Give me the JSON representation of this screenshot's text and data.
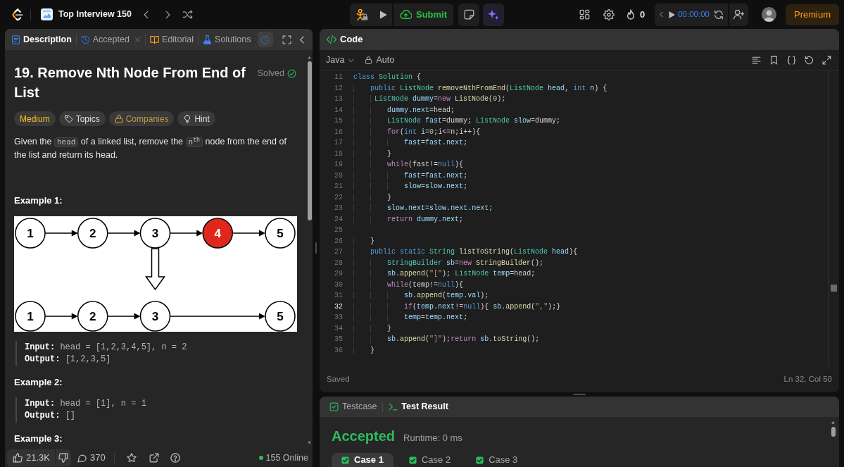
{
  "top_bar": {
    "study_plan": "Top Interview 150",
    "submit": "Submit",
    "streak": "0",
    "timer": "00:00:00",
    "premium": "Premium"
  },
  "description_panel": {
    "tabs": [
      {
        "kind": "description",
        "label": "Description",
        "selected": true,
        "closable": false
      },
      {
        "kind": "submission",
        "label": "Accepted",
        "selected": false,
        "closable": true
      },
      {
        "kind": "editorial",
        "label": "Editorial",
        "selected": false,
        "closable": false
      },
      {
        "kind": "solutions",
        "label": "Solutions",
        "selected": false,
        "closable": false
      }
    ],
    "title": "19. Remove Nth Node From End of List",
    "status": "Solved",
    "tags": [
      {
        "kind": "difficulty",
        "label": "Medium"
      },
      {
        "kind": "topics",
        "label": "Topics"
      },
      {
        "kind": "companies",
        "label": "Companies"
      },
      {
        "kind": "hint",
        "label": "Hint"
      }
    ],
    "statement": [
      {
        "kind": "text",
        "text": "Given the "
      },
      {
        "kind": "code",
        "text": "head"
      },
      {
        "kind": "text",
        "text": " of a linked list, remove the "
      },
      {
        "kind": "code",
        "text": "n$^{th}$"
      },
      {
        "kind": "text",
        "text": " node from the end of the list and return its head."
      }
    ],
    "examples": [
      {
        "title": "Example 1:",
        "diagram": {
          "rows": [
            {
              "nodes": [
                {
                  "label": "1",
                  "highlighted": false
                },
                {
                  "label": "2",
                  "highlighted": false
                },
                {
                  "label": "3",
                  "highlighted": false
                },
                {
                  "label": "4",
                  "highlighted": true
                },
                {
                  "label": "5",
                  "highlighted": false
                }
              ]
            },
            {
              "nodes": [
                {
                  "label": "1",
                  "highlighted": false
                },
                {
                  "label": "2",
                  "highlighted": false
                },
                {
                  "label": "3",
                  "highlighted": false
                },
                {
                  "label": "5",
                  "highlighted": false
                }
              ]
            }
          ]
        },
        "input_label": "Input:",
        "input": "head = [1,2,3,4,5], n = 2",
        "output_label": "Output:",
        "output": "[1,2,3,5]"
      },
      {
        "title": "Example 2:",
        "input_label": "Input:",
        "input": "head = [1], n = 1",
        "output_label": "Output:",
        "output": "[]"
      },
      {
        "title": "Example 3:"
      }
    ],
    "footer": {
      "likes": "21.3K",
      "comments": "370",
      "online": "155 Online"
    }
  },
  "code_panel": {
    "title": "Code",
    "language": "Java",
    "mode": "Auto",
    "lines": [
      {
        "number": "11",
        "active": false,
        "tokens": [
          {
            "kind": "keyword",
            "text": "class"
          },
          {
            "kind": "type",
            "text": " Solution"
          },
          {
            "kind": "plain",
            "text": " {"
          }
        ]
      },
      {
        "number": "12",
        "active": false,
        "tokens": [
          {
            "kind": "keyword",
            "text": "    public"
          },
          {
            "kind": "type",
            "text": " ListNode"
          },
          {
            "kind": "function",
            "text": " removeNthFromEnd"
          },
          {
            "kind": "plain",
            "text": "("
          },
          {
            "kind": "type",
            "text": "ListNode"
          },
          {
            "kind": "variable",
            "text": " head"
          },
          {
            "kind": "plain",
            "text": ", "
          },
          {
            "kind": "keyword",
            "text": "int"
          },
          {
            "kind": "variable",
            "text": " n"
          },
          {
            "kind": "plain",
            "text": ") {"
          }
        ]
      },
      {
        "number": "13",
        "active": false,
        "tokens": [
          {
            "kind": "type",
            "text": "     ListNode"
          },
          {
            "kind": "variable",
            "text": " dummy"
          },
          {
            "kind": "plain",
            "text": "="
          },
          {
            "kind": "control",
            "text": "new"
          },
          {
            "kind": "function",
            "text": " ListNode"
          },
          {
            "kind": "plain",
            "text": "("
          },
          {
            "kind": "number",
            "text": "0"
          },
          {
            "kind": "plain",
            "text": ");"
          }
        ]
      },
      {
        "number": "14",
        "active": false,
        "tokens": [
          {
            "kind": "variable",
            "text": "        dummy"
          },
          {
            "kind": "plain",
            "text": "."
          },
          {
            "kind": "variable",
            "text": "next"
          },
          {
            "kind": "plain",
            "text": "=head;"
          }
        ]
      },
      {
        "number": "15",
        "active": false,
        "tokens": [
          {
            "kind": "type",
            "text": "        ListNode"
          },
          {
            "kind": "variable",
            "text": " fast"
          },
          {
            "kind": "plain",
            "text": "=dummy; "
          },
          {
            "kind": "type",
            "text": "ListNode"
          },
          {
            "kind": "variable",
            "text": " slow"
          },
          {
            "kind": "plain",
            "text": "=dummy;"
          }
        ]
      },
      {
        "number": "16",
        "active": false,
        "tokens": [
          {
            "kind": "control",
            "text": "        for"
          },
          {
            "kind": "plain",
            "text": "("
          },
          {
            "kind": "keyword",
            "text": "int"
          },
          {
            "kind": "variable",
            "text": " i"
          },
          {
            "kind": "plain",
            "text": "="
          },
          {
            "kind": "number",
            "text": "0"
          },
          {
            "kind": "plain",
            "text": ";i<=n;i++){"
          }
        ]
      },
      {
        "number": "17",
        "active": false,
        "tokens": [
          {
            "kind": "variable",
            "text": "            fast"
          },
          {
            "kind": "plain",
            "text": "="
          },
          {
            "kind": "variable",
            "text": "fast"
          },
          {
            "kind": "plain",
            "text": "."
          },
          {
            "kind": "variable",
            "text": "next"
          },
          {
            "kind": "plain",
            "text": ";"
          }
        ]
      },
      {
        "number": "18",
        "active": false,
        "tokens": [
          {
            "kind": "plain",
            "text": "        }"
          }
        ]
      },
      {
        "number": "19",
        "active": false,
        "tokens": [
          {
            "kind": "control",
            "text": "        while"
          },
          {
            "kind": "plain",
            "text": "(fast!="
          },
          {
            "kind": "keyword",
            "text": "null"
          },
          {
            "kind": "plain",
            "text": "){"
          }
        ]
      },
      {
        "number": "20",
        "active": false,
        "tokens": [
          {
            "kind": "variable",
            "text": "            fast"
          },
          {
            "kind": "plain",
            "text": "="
          },
          {
            "kind": "variable",
            "text": "fast"
          },
          {
            "kind": "plain",
            "text": "."
          },
          {
            "kind": "variable",
            "text": "next"
          },
          {
            "kind": "plain",
            "text": ";"
          }
        ]
      },
      {
        "number": "21",
        "active": false,
        "tokens": [
          {
            "kind": "variable",
            "text": "            slow"
          },
          {
            "kind": "plain",
            "text": "="
          },
          {
            "kind": "variable",
            "text": "slow"
          },
          {
            "kind": "plain",
            "text": "."
          },
          {
            "kind": "variable",
            "text": "next"
          },
          {
            "kind": "plain",
            "text": ";"
          }
        ]
      },
      {
        "number": "22",
        "active": false,
        "tokens": [
          {
            "kind": "plain",
            "text": "        }"
          }
        ]
      },
      {
        "number": "23",
        "active": false,
        "tokens": [
          {
            "kind": "variable",
            "text": "        slow"
          },
          {
            "kind": "plain",
            "text": "."
          },
          {
            "kind": "variable",
            "text": "next"
          },
          {
            "kind": "plain",
            "text": "="
          },
          {
            "kind": "variable",
            "text": "slow"
          },
          {
            "kind": "plain",
            "text": "."
          },
          {
            "kind": "variable",
            "text": "next"
          },
          {
            "kind": "plain",
            "text": "."
          },
          {
            "kind": "variable",
            "text": "next"
          },
          {
            "kind": "plain",
            "text": ";"
          }
        ]
      },
      {
        "number": "24",
        "active": false,
        "tokens": [
          {
            "kind": "control",
            "text": "        return"
          },
          {
            "kind": "variable",
            "text": " dummy"
          },
          {
            "kind": "plain",
            "text": "."
          },
          {
            "kind": "variable",
            "text": "next"
          },
          {
            "kind": "plain",
            "text": ";"
          }
        ]
      },
      {
        "number": "25",
        "active": false
      },
      {
        "number": "26",
        "active": false,
        "tokens": [
          {
            "kind": "plain",
            "text": "    }"
          }
        ]
      },
      {
        "number": "27",
        "active": false,
        "tokens": [
          {
            "kind": "keyword",
            "text": "    public"
          },
          {
            "kind": "keyword",
            "text": " static"
          },
          {
            "kind": "type",
            "text": " String"
          },
          {
            "kind": "function",
            "text": " listToString"
          },
          {
            "kind": "plain",
            "text": "("
          },
          {
            "kind": "type",
            "text": "ListNode"
          },
          {
            "kind": "variable",
            "text": " head"
          },
          {
            "kind": "plain",
            "text": "){"
          }
        ]
      },
      {
        "number": "28",
        "active": false,
        "tokens": [
          {
            "kind": "type",
            "text": "        StringBuilder"
          },
          {
            "kind": "variable",
            "text": " sb"
          },
          {
            "kind": "plain",
            "text": "="
          },
          {
            "kind": "control",
            "text": "new"
          },
          {
            "kind": "function",
            "text": " StringBuilder"
          },
          {
            "kind": "plain",
            "text": "();"
          }
        ]
      },
      {
        "number": "29",
        "active": false,
        "tokens": [
          {
            "kind": "variable",
            "text": "        sb"
          },
          {
            "kind": "plain",
            "text": "."
          },
          {
            "kind": "function",
            "text": "append"
          },
          {
            "kind": "plain",
            "text": "("
          },
          {
            "kind": "string",
            "text": "\"[\""
          },
          {
            "kind": "plain",
            "text": "); "
          },
          {
            "kind": "type",
            "text": "ListNode"
          },
          {
            "kind": "variable",
            "text": " temp"
          },
          {
            "kind": "plain",
            "text": "=head;"
          }
        ]
      },
      {
        "number": "30",
        "active": false,
        "tokens": [
          {
            "kind": "control",
            "text": "        while"
          },
          {
            "kind": "plain",
            "text": "(temp!="
          },
          {
            "kind": "keyword",
            "text": "null"
          },
          {
            "kind": "plain",
            "text": "){"
          }
        ]
      },
      {
        "number": "31",
        "active": false,
        "tokens": [
          {
            "kind": "variable",
            "text": "            sb"
          },
          {
            "kind": "plain",
            "text": "."
          },
          {
            "kind": "function",
            "text": "append"
          },
          {
            "kind": "plain",
            "text": "("
          },
          {
            "kind": "variable",
            "text": "temp"
          },
          {
            "kind": "plain",
            "text": "."
          },
          {
            "kind": "variable",
            "text": "val"
          },
          {
            "kind": "plain",
            "text": ");"
          }
        ]
      },
      {
        "number": "32",
        "active": true,
        "tokens": [
          {
            "kind": "control",
            "text": "            if"
          },
          {
            "kind": "plain",
            "text": "("
          },
          {
            "kind": "variable",
            "text": "temp"
          },
          {
            "kind": "plain",
            "text": "."
          },
          {
            "kind": "variable",
            "text": "next"
          },
          {
            "kind": "plain",
            "text": "!="
          },
          {
            "kind": "keyword",
            "text": "null"
          },
          {
            "kind": "plain",
            "text": "){ "
          },
          {
            "kind": "variable",
            "text": "sb"
          },
          {
            "kind": "plain",
            "text": "."
          },
          {
            "kind": "function",
            "text": "append"
          },
          {
            "kind": "plain",
            "text": "("
          },
          {
            "kind": "string",
            "text": "\",\""
          },
          {
            "kind": "plain",
            "text": ");}"
          }
        ]
      },
      {
        "number": "33",
        "active": false,
        "tokens": [
          {
            "kind": "variable",
            "text": "            temp"
          },
          {
            "kind": "plain",
            "text": "="
          },
          {
            "kind": "variable",
            "text": "temp"
          },
          {
            "kind": "plain",
            "text": "."
          },
          {
            "kind": "variable",
            "text": "next"
          },
          {
            "kind": "plain",
            "text": ";"
          }
        ]
      },
      {
        "number": "34",
        "active": false,
        "tokens": [
          {
            "kind": "plain",
            "text": "        }"
          }
        ]
      },
      {
        "number": "35",
        "active": false,
        "tokens": [
          {
            "kind": "variable",
            "text": "        sb"
          },
          {
            "kind": "plain",
            "text": "."
          },
          {
            "kind": "function",
            "text": "append"
          },
          {
            "kind": "plain",
            "text": "("
          },
          {
            "kind": "string",
            "text": "\"]\""
          },
          {
            "kind": "plain",
            "text": ");"
          },
          {
            "kind": "control",
            "text": "return"
          },
          {
            "kind": "variable",
            "text": " sb"
          },
          {
            "kind": "plain",
            "text": "."
          },
          {
            "kind": "function",
            "text": "toString"
          },
          {
            "kind": "plain",
            "text": "();"
          }
        ]
      },
      {
        "number": "36",
        "active": false,
        "tokens": [
          {
            "kind": "plain",
            "text": "    }"
          }
        ]
      }
    ],
    "status": "Saved",
    "cursor": "Ln 32, Col 50"
  },
  "test_panel": {
    "tabs": [
      {
        "kind": "testcase",
        "label": "Testcase",
        "selected": false
      },
      {
        "kind": "result",
        "label": "Test Result",
        "selected": true
      }
    ],
    "verdict": "Accepted",
    "runtime": "Runtime: 0 ms",
    "cases": [
      {
        "label": "Case 1",
        "selected": true,
        "passed": true
      },
      {
        "label": "Case 2",
        "selected": false,
        "passed": true
      },
      {
        "label": "Case 3",
        "selected": false,
        "passed": true
      }
    ]
  }
}
